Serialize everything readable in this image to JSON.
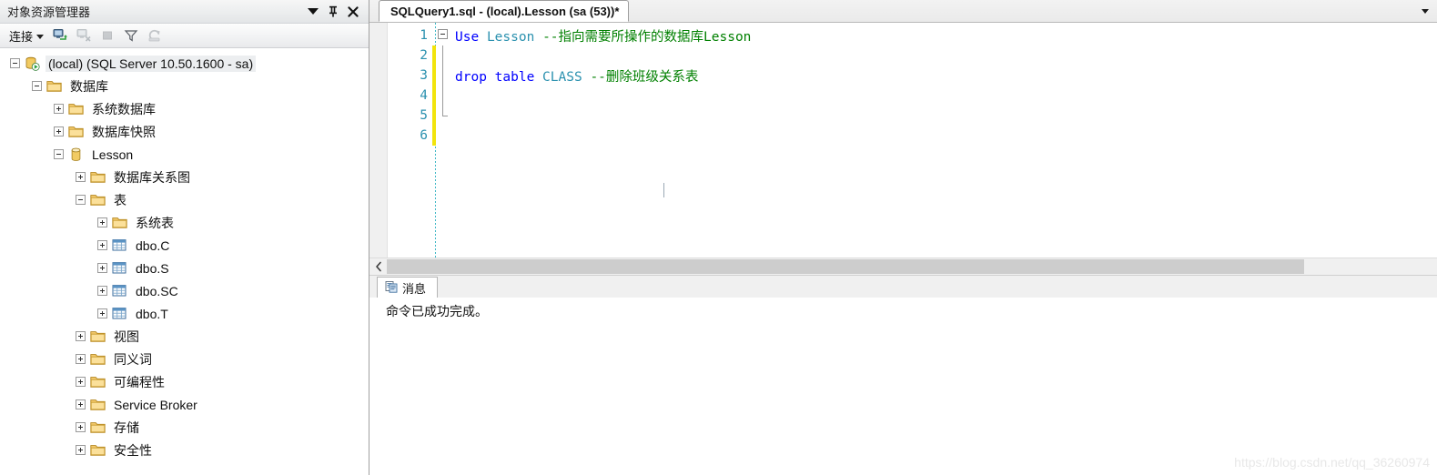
{
  "object_explorer": {
    "title": "对象资源管理器",
    "title_buttons": {
      "dropdown": "window-menu",
      "pin": "auto-hide-pin",
      "close": "close"
    },
    "toolbar": {
      "connect_label": "连接",
      "buttons": [
        {
          "name": "connect-object-explorer",
          "enabled": true
        },
        {
          "name": "disconnect-object-explorer",
          "enabled": false
        },
        {
          "name": "stop-action",
          "enabled": false
        },
        {
          "name": "filter",
          "enabled": true
        },
        {
          "name": "refresh",
          "enabled": false
        }
      ]
    },
    "tree": [
      {
        "label": "(local) (SQL Server 10.50.1600 - sa)",
        "depth": 0,
        "state": "expanded",
        "icon": "server-icon",
        "selected": true
      },
      {
        "label": "数据库",
        "depth": 1,
        "state": "expanded",
        "icon": "folder-icon",
        "selected": false
      },
      {
        "label": "系统数据库",
        "depth": 2,
        "state": "collapsed",
        "icon": "folder-icon",
        "selected": false
      },
      {
        "label": "数据库快照",
        "depth": 2,
        "state": "collapsed",
        "icon": "folder-icon",
        "selected": false
      },
      {
        "label": "Lesson",
        "depth": 2,
        "state": "expanded",
        "icon": "database-icon",
        "selected": false
      },
      {
        "label": "数据库关系图",
        "depth": 3,
        "state": "collapsed",
        "icon": "folder-icon",
        "selected": false
      },
      {
        "label": "表",
        "depth": 3,
        "state": "expanded",
        "icon": "folder-icon",
        "selected": false
      },
      {
        "label": "系统表",
        "depth": 4,
        "state": "collapsed",
        "icon": "folder-icon",
        "selected": false
      },
      {
        "label": "dbo.C",
        "depth": 4,
        "state": "collapsed",
        "icon": "table-icon",
        "selected": false
      },
      {
        "label": "dbo.S",
        "depth": 4,
        "state": "collapsed",
        "icon": "table-icon",
        "selected": false
      },
      {
        "label": "dbo.SC",
        "depth": 4,
        "state": "collapsed",
        "icon": "table-icon",
        "selected": false
      },
      {
        "label": "dbo.T",
        "depth": 4,
        "state": "collapsed",
        "icon": "table-icon",
        "selected": false
      },
      {
        "label": "视图",
        "depth": 3,
        "state": "collapsed",
        "icon": "folder-icon",
        "selected": false
      },
      {
        "label": "同义词",
        "depth": 3,
        "state": "collapsed",
        "icon": "folder-icon",
        "selected": false
      },
      {
        "label": "可编程性",
        "depth": 3,
        "state": "collapsed",
        "icon": "folder-icon",
        "selected": false
      },
      {
        "label": "Service Broker",
        "depth": 3,
        "state": "collapsed",
        "icon": "folder-icon",
        "selected": false
      },
      {
        "label": "存储",
        "depth": 3,
        "state": "collapsed",
        "icon": "folder-icon",
        "selected": false
      },
      {
        "label": "安全性",
        "depth": 3,
        "state": "collapsed",
        "icon": "folder-icon",
        "selected": false
      }
    ]
  },
  "editor": {
    "tab_title": "SQLQuery1.sql - (local).Lesson (sa (53))*",
    "lines": [
      {
        "number": "1",
        "segments": [
          {
            "text": "Use",
            "kind": "keyword"
          },
          {
            "text": " ",
            "kind": "plain"
          },
          {
            "text": "Lesson",
            "kind": "identifier"
          },
          {
            "text": " ",
            "kind": "plain"
          },
          {
            "text": "--指向需要所操作的数据库Lesson",
            "kind": "comment"
          }
        ]
      },
      {
        "number": "2",
        "segments": []
      },
      {
        "number": "3",
        "segments": [
          {
            "text": "drop",
            "kind": "keyword"
          },
          {
            "text": " ",
            "kind": "plain"
          },
          {
            "text": "table",
            "kind": "keyword"
          },
          {
            "text": " ",
            "kind": "plain"
          },
          {
            "text": "CLASS",
            "kind": "identifier"
          },
          {
            "text": " ",
            "kind": "plain"
          },
          {
            "text": "--删除班级关系表",
            "kind": "comment"
          }
        ]
      },
      {
        "number": "4",
        "segments": []
      },
      {
        "number": "5",
        "segments": []
      },
      {
        "number": "6",
        "segments": []
      }
    ],
    "colors": {
      "keyword": "#0000ff",
      "identifier": "#2b91af",
      "comment": "#008000",
      "line_number": "#2b91af",
      "change_bar": "#f2e40c"
    }
  },
  "results": {
    "tab_label": "消息",
    "tab_icon": "messages-icon",
    "message": "命令已成功完成。"
  },
  "watermark": "https://blog.csdn.net/qq_36260974"
}
